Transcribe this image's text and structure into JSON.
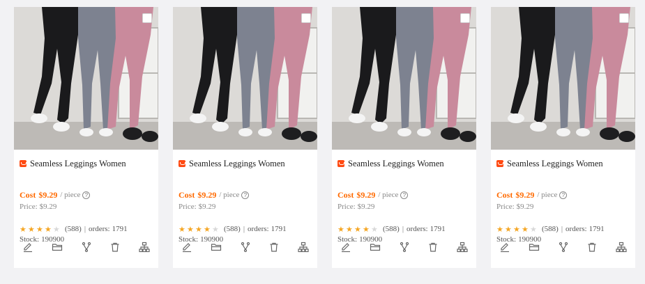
{
  "products": [
    {
      "title": "Seamless Leggings Women",
      "cost_label": "Cost",
      "cost_value": "$9.29",
      "unit": "/ piece",
      "price_label": "Price:",
      "price_value": "$9.29",
      "rating": 4,
      "rating_max": 5,
      "reviews": "(588)",
      "orders_label": "orders:",
      "orders_value": "1791",
      "stock_label": "Stock:",
      "stock_value": "190900"
    },
    {
      "title": "Seamless Leggings Women",
      "cost_label": "Cost",
      "cost_value": "$9.29",
      "unit": "/ piece",
      "price_label": "Price:",
      "price_value": "$9.29",
      "rating": 4,
      "rating_max": 5,
      "reviews": "(588)",
      "orders_label": "orders:",
      "orders_value": "1791",
      "stock_label": "Stock:",
      "stock_value": "190900"
    },
    {
      "title": "Seamless Leggings Women",
      "cost_label": "Cost",
      "cost_value": "$9.29",
      "unit": "/ piece",
      "price_label": "Price:",
      "price_value": "$9.29",
      "rating": 4,
      "rating_max": 5,
      "reviews": "(588)",
      "orders_label": "orders:",
      "orders_value": "1791",
      "stock_label": "Stock:",
      "stock_value": "190900"
    },
    {
      "title": "Seamless Leggings Women",
      "cost_label": "Cost",
      "cost_value": "$9.29",
      "unit": "/ piece",
      "price_label": "Price:",
      "price_value": "$9.29",
      "rating": 4,
      "rating_max": 5,
      "reviews": "(588)",
      "orders_label": "orders:",
      "orders_value": "1791",
      "stock_label": "Stock:",
      "stock_value": "190900"
    }
  ],
  "help_glyph": "?",
  "star_glyph": "★",
  "separator": "|",
  "action_icons": [
    "edit-icon",
    "folder-icon",
    "split-icon",
    "trash-icon",
    "sitemap-icon"
  ],
  "colors": {
    "accent": "#ff6a00",
    "shop_badge": "#ff4a12",
    "star_filled": "#f5a623",
    "star_empty": "#d8d8d8",
    "leggings": [
      "#1a1a1c",
      "#7d8290",
      "#c98a9c"
    ]
  }
}
